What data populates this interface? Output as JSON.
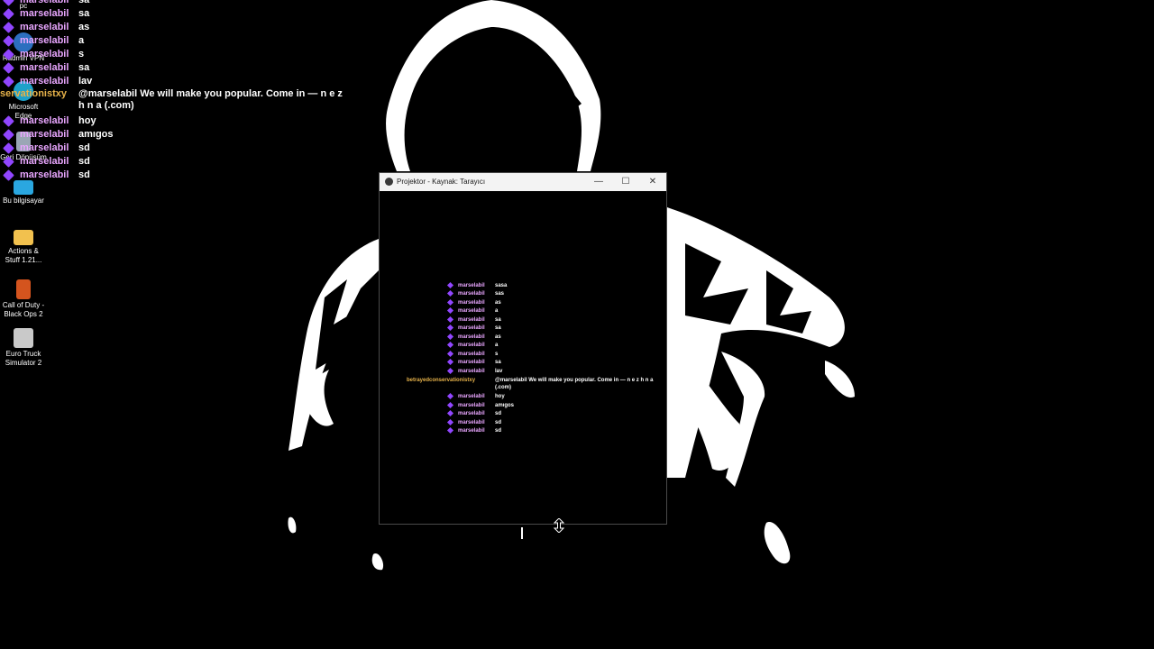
{
  "desktop": {
    "icons": [
      {
        "name": "pc",
        "label": "pc",
        "color": "#4a90d9"
      },
      {
        "name": "radmin-vpn",
        "label": "Radmin VPN",
        "color": "#2c6fbf"
      },
      {
        "name": "microsoft-edge",
        "label": "Microsoft Edge",
        "color": "#1ea1c9"
      },
      {
        "name": "geri-donusum",
        "label": "Geri Dönüşüm",
        "color": "#9aa6b5"
      },
      {
        "name": "bu-bilgisayar",
        "label": "Bu bilgisayar",
        "color": "#2aa7e0"
      },
      {
        "name": "actions-stuff",
        "label": "Actions & Stuff 1.21...",
        "color": "#f2c14e"
      },
      {
        "name": "call-of-duty",
        "label": "Call of Duty - Black Ops 2",
        "color": "#d4541e"
      },
      {
        "name": "euro-truck",
        "label": "Euro Truck Simulator 2",
        "color": "#c9c9c9"
      }
    ]
  },
  "chat": [
    {
      "user": "marselabil",
      "msg": "sa"
    },
    {
      "user": "marselabil",
      "msg": "sa"
    },
    {
      "user": "marselabil",
      "msg": "as"
    },
    {
      "user": "marselabil",
      "msg": "a"
    },
    {
      "user": "marselabil",
      "msg": "s"
    },
    {
      "user": "marselabil",
      "msg": "sa"
    },
    {
      "user": "marselabil",
      "msg": "lav"
    },
    {
      "user": "servationistxy",
      "msg": "@marselabil We will make you popular. Come in — n e z h n a (.com)",
      "special": true
    },
    {
      "user": "marselabil",
      "msg": "hoy"
    },
    {
      "user": "marselabil",
      "msg": "amıgos"
    },
    {
      "user": "marselabil",
      "msg": "sd"
    },
    {
      "user": "marselabil",
      "msg": "sd"
    },
    {
      "user": "marselabil",
      "msg": "sd"
    }
  ],
  "projector": {
    "title": "Projektor - Kaynak: Tarayıcı",
    "minimize": "—",
    "maximize": "☐",
    "close": "✕",
    "chat": [
      {
        "user": "marselabil",
        "msg": "sasa"
      },
      {
        "user": "marselabil",
        "msg": "sas"
      },
      {
        "user": "marselabil",
        "msg": "as"
      },
      {
        "user": "marselabil",
        "msg": "a"
      },
      {
        "user": "marselabil",
        "msg": "sa"
      },
      {
        "user": "marselabil",
        "msg": "sa"
      },
      {
        "user": "marselabil",
        "msg": "as"
      },
      {
        "user": "marselabil",
        "msg": "a"
      },
      {
        "user": "marselabil",
        "msg": "s"
      },
      {
        "user": "marselabil",
        "msg": "sa"
      },
      {
        "user": "marselabil",
        "msg": "lav"
      },
      {
        "user": "betrayedconservationistxy",
        "msg": "@marselabil We will make you popular. Come in — n e z h n a (.com)",
        "special": true
      },
      {
        "user": "marselabil",
        "msg": "hoy"
      },
      {
        "user": "marselabil",
        "msg": "amıgos"
      },
      {
        "user": "marselabil",
        "msg": "sd"
      },
      {
        "user": "marselabil",
        "msg": "sd"
      },
      {
        "user": "marselabil",
        "msg": "sd"
      }
    ]
  },
  "colors": {
    "badge": "#9146ff",
    "username": "#e9a6ff",
    "special_username": "#e6b24a"
  }
}
